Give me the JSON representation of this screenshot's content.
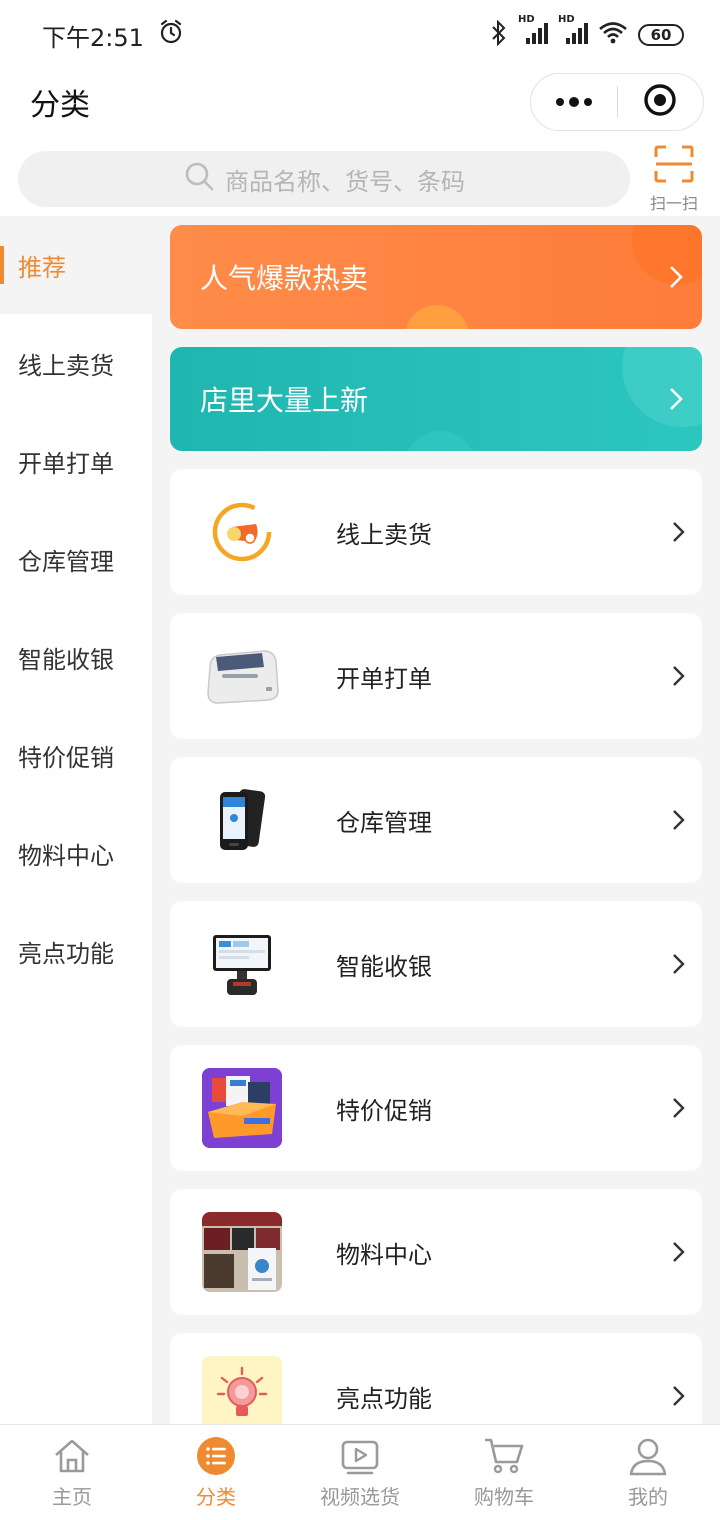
{
  "status_bar": {
    "time": "下午2:51",
    "network_1": "HD",
    "network_2": "HD",
    "battery": "60"
  },
  "header": {
    "title": "分类"
  },
  "search": {
    "placeholder": "商品名称、货号、条码",
    "scan_label": "扫一扫"
  },
  "sidebar": {
    "items": [
      {
        "label": "推荐",
        "active": true
      },
      {
        "label": "线上卖货"
      },
      {
        "label": "开单打单"
      },
      {
        "label": "仓库管理"
      },
      {
        "label": "智能收银"
      },
      {
        "label": "特价促销"
      },
      {
        "label": "物料中心"
      },
      {
        "label": "亮点功能"
      }
    ]
  },
  "banners": [
    {
      "label": "人气爆款热卖",
      "color": "#ff8440"
    },
    {
      "label": "店里大量上新",
      "color": "#26bfb9"
    }
  ],
  "cards": [
    {
      "label": "线上卖货",
      "icon": "online-sales-icon"
    },
    {
      "label": "开单打单",
      "icon": "receipt-printer-icon"
    },
    {
      "label": "仓库管理",
      "icon": "handheld-scanner-icon"
    },
    {
      "label": "智能收银",
      "icon": "pos-terminal-icon"
    },
    {
      "label": "特价促销",
      "icon": "promotion-box-icon"
    },
    {
      "label": "物料中心",
      "icon": "materials-shelf-icon"
    },
    {
      "label": "亮点功能",
      "icon": "lightbulb-icon"
    }
  ],
  "tab_bar": {
    "tabs": [
      {
        "label": "主页",
        "icon": "home-icon"
      },
      {
        "label": "分类",
        "icon": "category-list-icon",
        "active": true
      },
      {
        "label": "视频选货",
        "icon": "video-play-icon"
      },
      {
        "label": "购物车",
        "icon": "cart-icon"
      },
      {
        "label": "我的",
        "icon": "user-icon"
      }
    ]
  },
  "colors": {
    "accent": "#f08a30",
    "hot_banner": "#ff8440",
    "new_banner": "#26bfb9",
    "background": "#f4f4f4"
  }
}
